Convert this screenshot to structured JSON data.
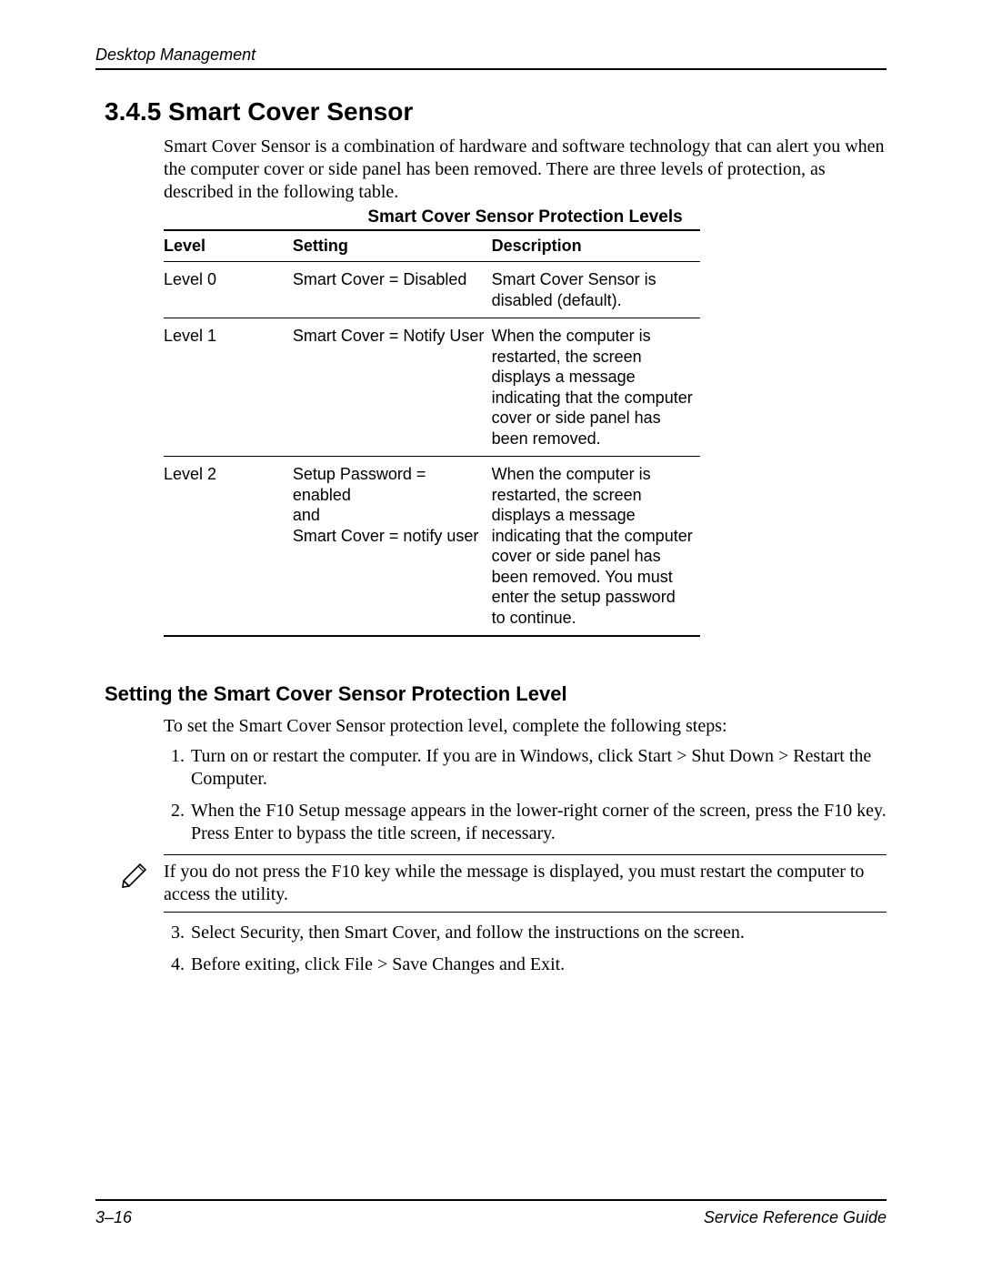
{
  "header": {
    "running_title": "Desktop Management"
  },
  "section": {
    "number_title": "3.4.5 Smart Cover Sensor",
    "intro": "Smart Cover Sensor is a combination of hardware and software technology that can alert you when the computer cover or side panel has been removed. There are three levels of protection, as described in the following table."
  },
  "table": {
    "title": "Smart Cover Sensor Protection Levels",
    "headers": {
      "level": "Level",
      "setting": "Setting",
      "description": "Description"
    },
    "rows": [
      {
        "level": "Level 0",
        "setting": "Smart Cover = Disabled",
        "description": "Smart Cover Sensor is disabled (default)."
      },
      {
        "level": "Level 1",
        "setting": "Smart Cover = Notify User",
        "description": "When the computer is restarted, the screen displays a message indicating that the computer cover or side panel has been removed."
      },
      {
        "level": "Level 2",
        "setting": "Setup Password = enabled\nand\nSmart Cover = notify user",
        "description": "When the computer is restarted, the screen displays a message indicating that the computer cover or side panel has been removed. You must enter the setup password to continue."
      }
    ]
  },
  "subsection": {
    "heading": "Setting the Smart Cover Sensor Protection Level",
    "intro": "To set the Smart Cover Sensor protection level, complete the following steps:",
    "steps": [
      "Turn on or restart the computer. If you are in Windows, click Start > Shut Down > Restart the Computer.",
      "When the F10 Setup message appears in the lower-right corner of the screen, press the F10 key. Press Enter to bypass the title screen, if necessary."
    ],
    "note": "If you do not press the F10 key while the message is displayed, you must restart the computer to access the utility.",
    "steps_after": [
      "Select Security, then Smart Cover, and follow the instructions on the screen.",
      "Before exiting, click File > Save Changes and Exit."
    ]
  },
  "footer": {
    "page": "3–16",
    "doc": "Service Reference Guide"
  }
}
